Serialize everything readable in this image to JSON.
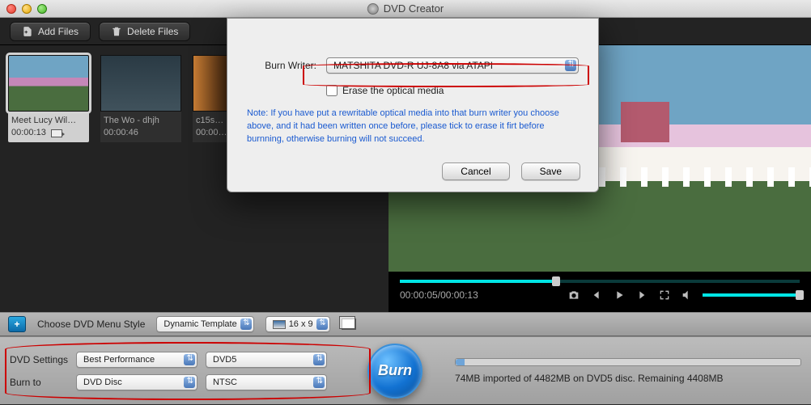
{
  "window": {
    "title": "DVD Creator"
  },
  "toolbar": {
    "add_label": "Add Files",
    "delete_label": "Delete Files"
  },
  "clips": [
    {
      "title": "Meet Lucy Wil…",
      "duration": "00:00:13",
      "selected": true
    },
    {
      "title": "The Wo - dhjh",
      "duration": "00:00:46",
      "selected": false
    },
    {
      "title": "c15s…",
      "duration": "00:00…",
      "selected": false
    }
  ],
  "preview": {
    "time_current": "00:00:05",
    "time_total": "00:00:13"
  },
  "menu_style": {
    "choose_label": "Choose DVD Menu Style",
    "template": "Dynamic Template",
    "aspect": "16 x 9"
  },
  "settings": {
    "dvd_settings_label": "DVD Settings",
    "burn_to_label": "Burn to",
    "quality": "Best Performance",
    "disc_type": "DVD5",
    "burn_target": "DVD Disc",
    "format": "NTSC"
  },
  "burn": {
    "label": "Burn"
  },
  "status": {
    "text": "74MB imported of 4482MB on DVD5 disc. Remaining 4408MB"
  },
  "modal": {
    "writer_label": "Burn Writer:",
    "writer_value": "MATSHITA DVD-R   UJ-8A8 via ATAPI",
    "erase_label": "Erase the optical media",
    "note": "Note: If you have put a rewritable optical media into that burn writer you choose above, and it had been written once before, please tick to erase it firt before burnning, otherwise burning will not succeed.",
    "cancel": "Cancel",
    "save": "Save"
  }
}
